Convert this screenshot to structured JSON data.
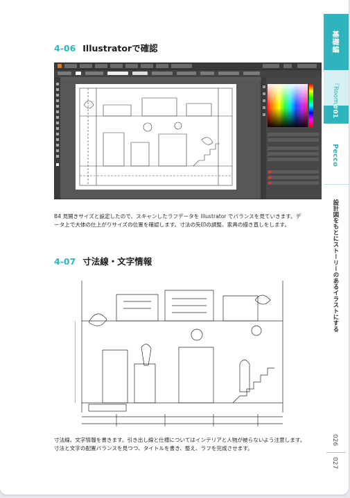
{
  "sections": [
    {
      "number": "4-06",
      "title": "Illustratorで確認",
      "body": [
        "B4 見開きサイズと設定したので、スキャンしたラフデータを Illustrator でバランスを見ていきます。デ",
        "ータ上で大体の仕上がりサイズの位置を確認します。寸法の矢印の調整、家具の描き直しをします。"
      ]
    },
    {
      "number": "4-07",
      "title": "寸法線・文字情報",
      "body": [
        "寸法線、文字情報を書きます。引き出し線と仕様についてはインテリアと人物が被らないよう注意します。",
        "寸法と文字の配置バランスを見つつ、タイトルを書き、整え、ラフを完成させます。"
      ]
    }
  ],
  "sidebar": {
    "tab_basics": "基礎編",
    "tab_room": "『Room』",
    "tab_room_number": "#01",
    "tab_artist": "Pecco",
    "book_title": "設計図をもとにストーリーのあるイラストにする",
    "page_numbers": [
      "026",
      "027"
    ]
  },
  "colors": {
    "accent": "#2fb3be",
    "accent_light": "#d6f0f2",
    "text": "#1c1c1c"
  },
  "images": {
    "screenshot": "illustrator-workspace-with-architectural-sketch",
    "sketch": "hand-drawn-interior-elevation-with-dimensions"
  }
}
